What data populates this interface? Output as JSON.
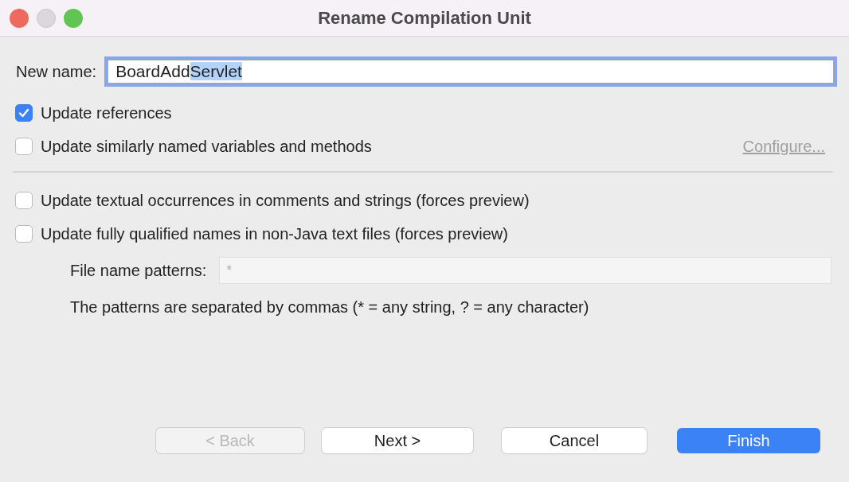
{
  "window": {
    "title": "Rename Compilation Unit"
  },
  "new_name": {
    "label": "New name:",
    "value_parts": [
      {
        "text": "BoardAdd",
        "selected": false
      },
      {
        "text": "Servlet",
        "selected": true
      }
    ]
  },
  "option_groups": [
    [
      {
        "label": "Update references",
        "checked": true
      },
      {
        "label": "Update similarly named variables and methods",
        "checked": false,
        "link": {
          "label": "Configure...",
          "disabled": true
        }
      }
    ],
    [
      {
        "label": "Update textual occurrences in comments and strings (forces preview)",
        "checked": false
      },
      {
        "label": "Update fully qualified names in non-Java text files (forces preview)",
        "checked": false
      }
    ]
  ],
  "patterns": {
    "label": "File name patterns:",
    "value": "*",
    "disabled": true,
    "hint": "The patterns are separated by commas (* = any string, ? = any character)"
  },
  "buttons": [
    {
      "label": "< Back",
      "kind": "normal",
      "disabled": true
    },
    {
      "label": "Next >",
      "kind": "normal",
      "disabled": false
    },
    {
      "label": "Cancel",
      "kind": "normal",
      "disabled": false
    },
    {
      "label": "Finish",
      "kind": "default",
      "disabled": false
    }
  ]
}
